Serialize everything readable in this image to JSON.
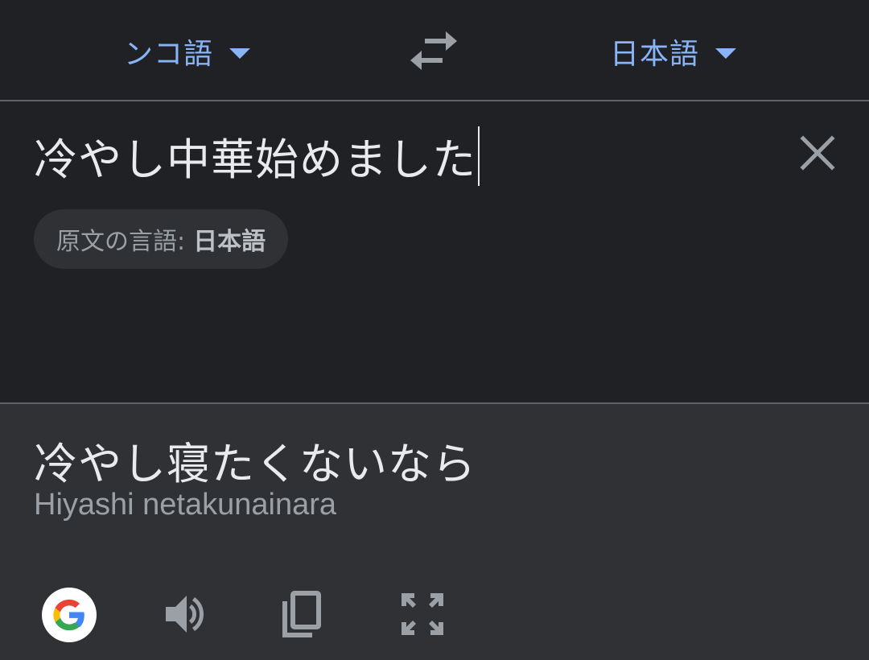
{
  "language_bar": {
    "source_language": "ンコ語",
    "target_language": "日本語"
  },
  "input": {
    "text": "冷やし中華始めました",
    "detected_label": "原文の言語:",
    "detected_language": "日本語"
  },
  "output": {
    "translation": "冷やし寝たくないなら",
    "romanization": "Hiyashi netakunainara"
  },
  "icons": {
    "swap": "swap-arrows-icon",
    "clear": "close-icon",
    "google": "google-logo",
    "speaker": "speaker-icon",
    "copy": "copy-icon",
    "fullscreen": "fullscreen-icon"
  },
  "colors": {
    "background": "#202124",
    "output_background": "#303134",
    "accent": "#8ab4f8",
    "text_primary": "#e8eaed",
    "text_secondary": "#9aa0a6",
    "icon": "#9aa0a6"
  }
}
